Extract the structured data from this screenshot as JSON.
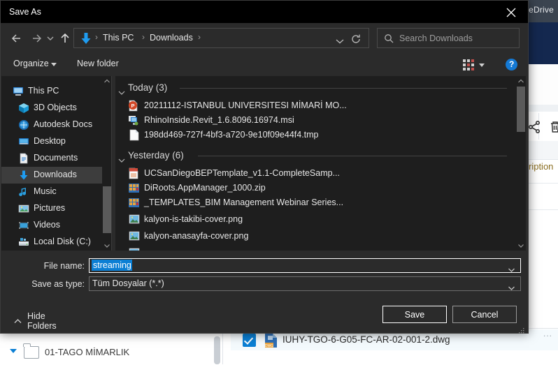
{
  "background": {
    "topbar_label": "neDrive",
    "description_label": "ription",
    "share_icon": "share-icon",
    "trash_icon": "trash-icon",
    "file_row": {
      "checked": true,
      "icon": "dwg-file-icon",
      "name": "IUHY-TGO-6-G05-FC-AR-02-001-2.dwg"
    },
    "tree_row": {
      "icon": "folder-icon",
      "label": "01-TAGO MİMARLIK"
    },
    "overflow_label": "..."
  },
  "dialog": {
    "title": "Save As",
    "close_icon": "close-icon",
    "nav": {
      "back_icon": "arrow-left-icon",
      "forward_icon": "arrow-right-icon",
      "recent_icon": "chevron-down-icon",
      "up_icon": "arrow-up-icon",
      "address_icon": "downloads-arrow-icon",
      "breadcrumbs": [
        "This PC",
        "Downloads"
      ],
      "separator": "›",
      "dropdown_icon": "chevron-down-icon",
      "refresh_icon": "refresh-icon"
    },
    "search": {
      "icon": "search-icon",
      "placeholder": "Search Downloads",
      "value": ""
    },
    "command_bar": {
      "organize_label": "Organize",
      "organize_caret": "caret-down-icon",
      "new_folder_label": "New folder",
      "view_icon": "view-grid-icon",
      "view_caret": "caret-down-icon",
      "help_icon": "help-icon",
      "help_label": "?"
    },
    "sidebar": {
      "items": [
        {
          "label": "This PC",
          "icon": "this-pc-icon",
          "selected": false,
          "root": true
        },
        {
          "label": "3D Objects",
          "icon": "3d-objects-icon",
          "selected": false,
          "root": false
        },
        {
          "label": "Autodesk Docs",
          "icon": "autodesk-docs-icon",
          "selected": false,
          "root": false
        },
        {
          "label": "Desktop",
          "icon": "desktop-icon",
          "selected": false,
          "root": false
        },
        {
          "label": "Documents",
          "icon": "documents-icon",
          "selected": false,
          "root": false
        },
        {
          "label": "Downloads",
          "icon": "downloads-icon",
          "selected": true,
          "root": false
        },
        {
          "label": "Music",
          "icon": "music-icon",
          "selected": false,
          "root": false
        },
        {
          "label": "Pictures",
          "icon": "pictures-icon",
          "selected": false,
          "root": false
        },
        {
          "label": "Videos",
          "icon": "videos-icon",
          "selected": false,
          "root": false
        },
        {
          "label": "Local Disk (C:)",
          "icon": "local-disk-icon",
          "selected": false,
          "root": false
        }
      ],
      "scroll_up_icon": "chevron-up-icon",
      "scroll_down_icon": "chevron-down-icon"
    },
    "file_list": {
      "groups": [
        {
          "label": "Today (3)",
          "chevron": "chevron-down-icon",
          "files": [
            {
              "name": "20211112-ISTANBUL UNIVERSITESI MİMARİ MO...",
              "icon": "powerpoint-file-icon"
            },
            {
              "name": "RhinoInside.Revit_1.6.8096.16974.msi",
              "icon": "msi-installer-icon"
            },
            {
              "name": "198dd469-727f-4bf3-a720-9e10f09e44f4.tmp",
              "icon": "blank-file-icon"
            }
          ]
        },
        {
          "label": "Yesterday (6)",
          "chevron": "chevron-down-icon",
          "files": [
            {
              "name": "UCSanDiegoBEPTemplate_v1.1-CompleteSamp...",
              "icon": "pdf-file-icon"
            },
            {
              "name": "DiRoots.AppManager_1000.zip",
              "icon": "zip-file-icon"
            },
            {
              "name": "_TEMPLATES_BIM Management Webinar Series...",
              "icon": "zip-file-icon"
            },
            {
              "name": "kalyon-is-takibi-cover.png",
              "icon": "png-image-icon"
            },
            {
              "name": "kalyon-anasayfa-cover.png",
              "icon": "png-image-icon"
            }
          ]
        }
      ],
      "scroll_up_icon": "chevron-up-icon",
      "scroll_down_icon": "chevron-down-icon"
    },
    "form": {
      "file_name_label": "File name:",
      "file_name_value": "streaming",
      "file_name_selected": true,
      "save_as_type_label": "Save as type:",
      "save_as_type_value": "Tüm Dosyalar (*.*)",
      "dropdown_icon": "chevron-down-icon",
      "hide_folders_label": "Hide Folders",
      "hide_folders_icon": "chevron-up-icon",
      "save_label": "Save",
      "cancel_label": "Cancel",
      "resize_grip_icon": "resize-grip-icon"
    }
  },
  "colors": {
    "accent_blue": "#0b7fd4",
    "dialog_bg": "#2b2b2b",
    "pane_bg": "#1e1e1e",
    "titlebar_bg": "#000000",
    "selection_blue": "#0b7fd4",
    "hero_navy": "#14284f"
  }
}
